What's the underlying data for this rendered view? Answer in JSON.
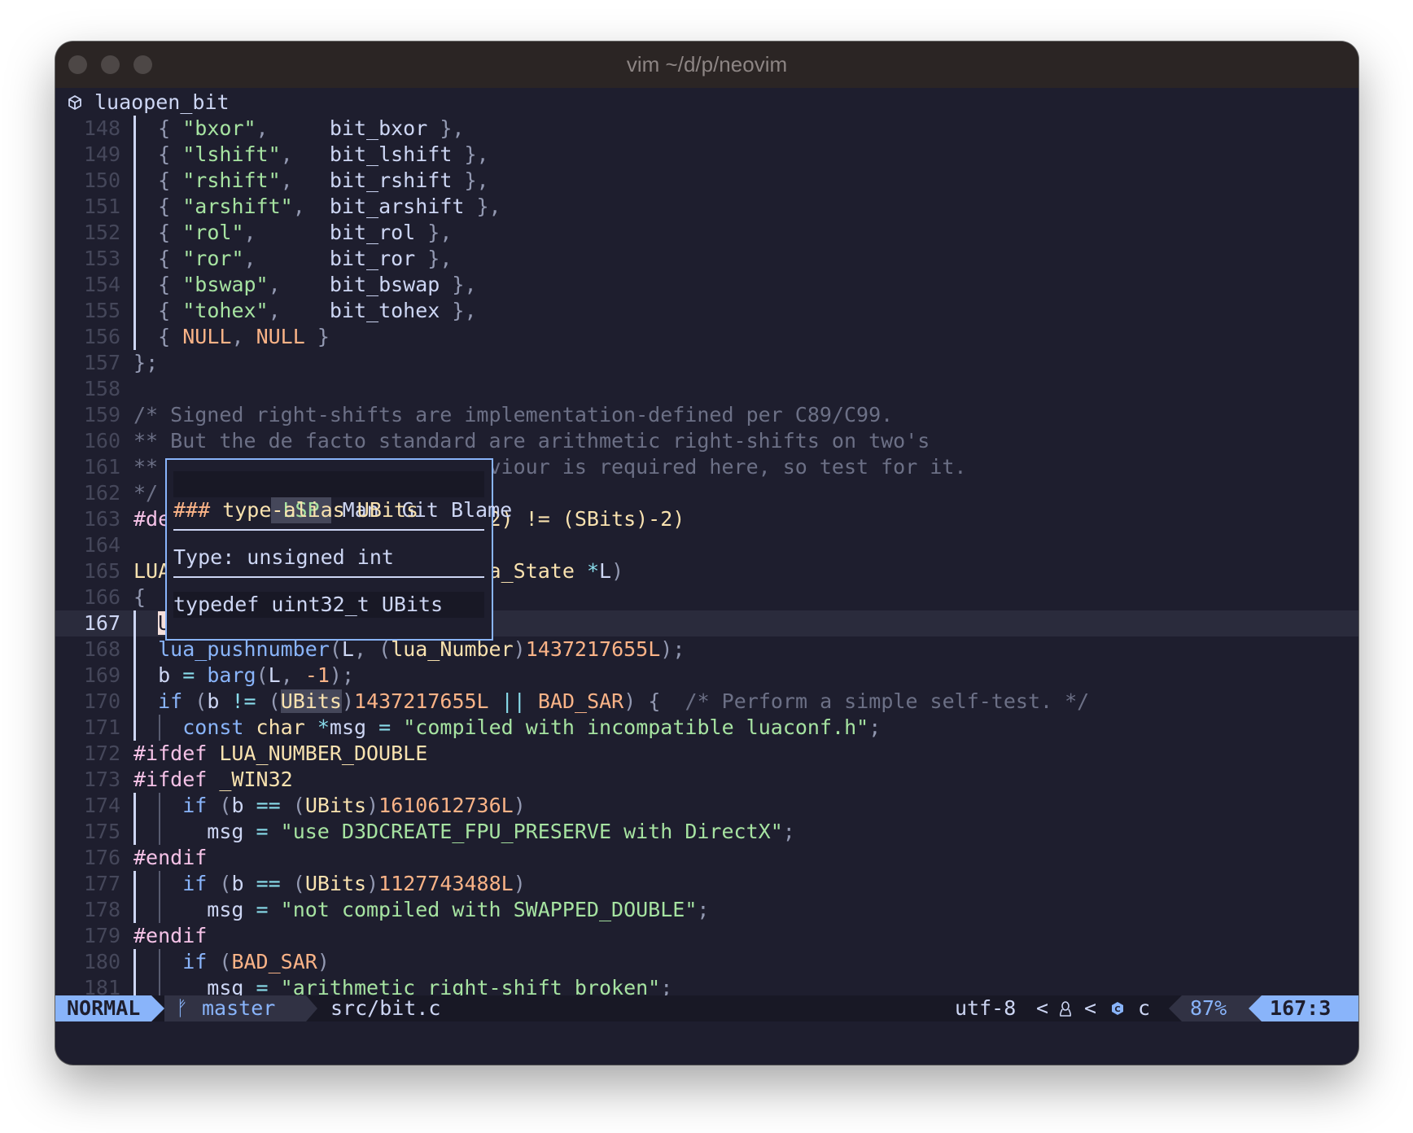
{
  "window": {
    "title": "vim ~/d/p/neovim"
  },
  "winbar": {
    "icon": "cube-icon",
    "symbol": "luaopen_bit"
  },
  "lines": [
    {
      "n": "148",
      "t": "  { \"bxor\",     bit_bxor },"
    },
    {
      "n": "149",
      "t": "  { \"lshift\",   bit_lshift },"
    },
    {
      "n": "150",
      "t": "  { \"rshift\",   bit_rshift },"
    },
    {
      "n": "151",
      "t": "  { \"arshift\",  bit_arshift },"
    },
    {
      "n": "152",
      "t": "  { \"rol\",      bit_rol },"
    },
    {
      "n": "153",
      "t": "  { \"ror\",      bit_ror },"
    },
    {
      "n": "154",
      "t": "  { \"bswap\",    bit_bswap },"
    },
    {
      "n": "155",
      "t": "  { \"tohex\",    bit_tohex },"
    },
    {
      "n": "156",
      "t": "  { NULL, NULL }"
    },
    {
      "n": "157",
      "t": "};"
    },
    {
      "n": "158",
      "t": ""
    },
    {
      "n": "159",
      "t": "/* Signed right-shifts are implementation-defined per C89/C99."
    },
    {
      "n": "160",
      "t": "** But the de facto standard are arithmetic right-shifts on two's"
    },
    {
      "n": "161",
      "t": "** complement CPUs. This behaviour is required here, so test for it."
    },
    {
      "n": "162",
      "t": "*/"
    },
    {
      "n": "163",
      "t": "#define BAD_SAR    (bsar(-8, 2) != (SBits)-2)"
    },
    {
      "n": "164",
      "t": ""
    },
    {
      "n": "165",
      "t": "LUALIB_API int luaopen_bit(lua_State *L)"
    },
    {
      "n": "166",
      "t": "{"
    },
    {
      "n": "167",
      "t": "  UBits b;"
    },
    {
      "n": "168",
      "t": "  lua_pushnumber(L, (lua_Number)1437217655L);"
    },
    {
      "n": "169",
      "t": "  b = barg(L, -1);"
    },
    {
      "n": "170",
      "t": "  if (b != (UBits)1437217655L || BAD_SAR) {  /* Perform a simple self-test. */"
    },
    {
      "n": "171",
      "t": "    const char *msg = \"compiled with incompatible luaconf.h\";"
    },
    {
      "n": "172",
      "t": "#ifdef LUA_NUMBER_DOUBLE"
    },
    {
      "n": "173",
      "t": "#ifdef _WIN32"
    },
    {
      "n": "174",
      "t": "    if (b == (UBits)1610612736L)"
    },
    {
      "n": "175",
      "t": "      msg = \"use D3DCREATE_FPU_PRESERVE with DirectX\";"
    },
    {
      "n": "176",
      "t": "#endif"
    },
    {
      "n": "177",
      "t": "    if (b == (UBits)1127743488L)"
    },
    {
      "n": "178",
      "t": "      msg = \"not compiled with SWAPPED_DOUBLE\";"
    },
    {
      "n": "179",
      "t": "#endif"
    },
    {
      "n": "180",
      "t": "    if (BAD_SAR)"
    },
    {
      "n": "181",
      "t": "      msg = \"arithmetic right-shift broken\";"
    }
  ],
  "hover": {
    "tabs": [
      "LSP",
      "Man",
      "Git Blame"
    ],
    "active_tab": "LSP",
    "heading": "### type-alias UBits",
    "type_line": "Type: unsigned int",
    "def_line": "typedef uint32_t UBits"
  },
  "statusline": {
    "mode": "NORMAL",
    "branch_icon": "git-branch-icon",
    "branch": "master",
    "file": "src/bit.c",
    "encoding": "utf-8",
    "os_icon": "linux-tux-icon",
    "filetype_icon": "c-language-icon",
    "filetype": "c",
    "percent": "87%",
    "position": "167:3"
  },
  "colors": {
    "background": "#1e1e2e",
    "keyword": "#89b4fa",
    "string": "#a6e3a1",
    "number": "#fab387",
    "type": "#f9e2af",
    "comment": "#6c7086",
    "mode_bg": "#89b4fa",
    "popup_border": "#89b4fa"
  }
}
